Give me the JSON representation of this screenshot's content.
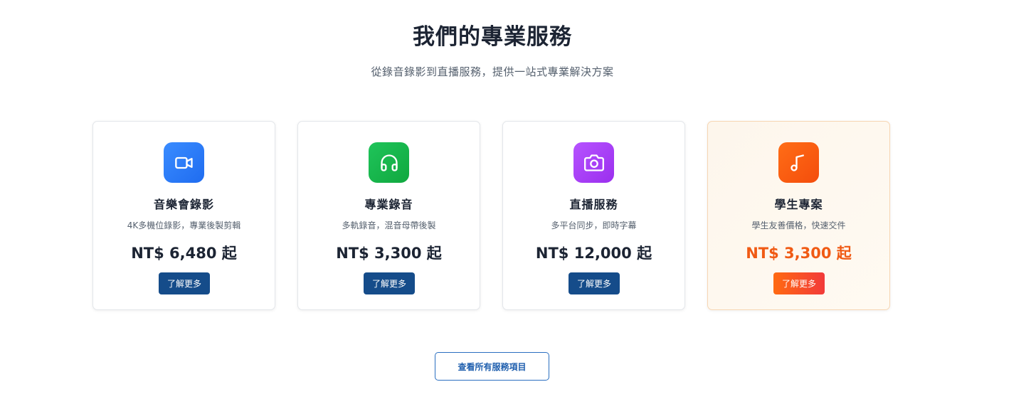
{
  "section": {
    "title": "我們的專業服務",
    "subtitle": "從錄音錄影到直播服務，提供一站式專業解決方案"
  },
  "cards": [
    {
      "title": "音樂會錄影",
      "description": "4K多機位錄影，專業後製剪輯",
      "price": "NT$ 6,480 起",
      "button_label": "了解更多",
      "icon": "video-camera-icon",
      "icon_color": "#2f7cf6"
    },
    {
      "title": "專業錄音",
      "description": "多軌錄音，混音母帶後製",
      "price": "NT$ 3,300 起",
      "button_label": "了解更多",
      "icon": "headphones-icon",
      "icon_color": "#16b54a"
    },
    {
      "title": "直播服務",
      "description": "多平台同步，即時字幕",
      "price": "NT$ 12,000 起",
      "button_label": "了解更多",
      "icon": "camera-icon",
      "icon_color": "#a53df5"
    },
    {
      "title": "學生專案",
      "description": "學生友善價格，快速交件",
      "price": "NT$ 3,300 起",
      "button_label": "了解更多",
      "icon": "music-note-icon",
      "icon_color": "#fb5a10"
    }
  ],
  "all_services_button": "查看所有服務項目",
  "colors": {
    "primary_button": "#154c8a",
    "featured_accent": "#f05a14",
    "outline_button": "#2a6fc0"
  }
}
